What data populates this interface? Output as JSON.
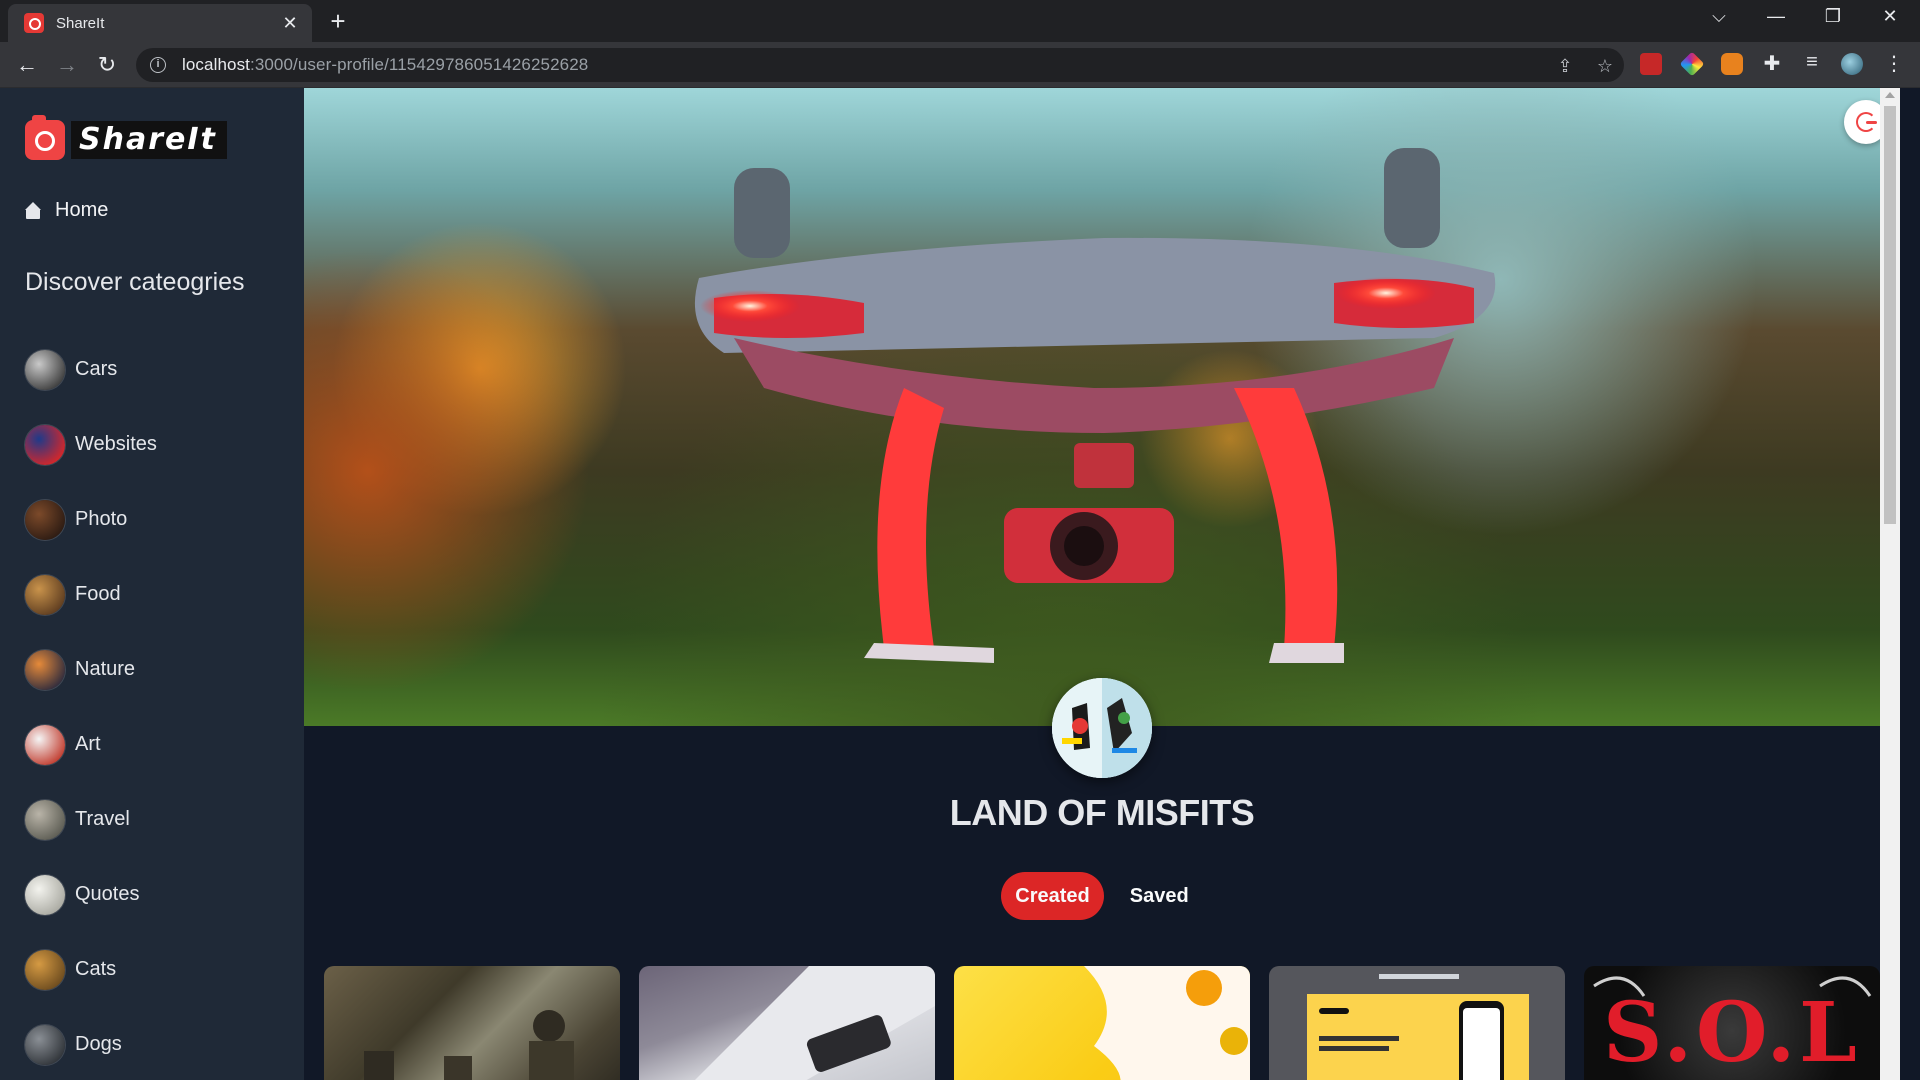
{
  "browser": {
    "tab_title": "ShareIt",
    "tab_close": "✕",
    "new_tab": "+",
    "url_host": "localhost",
    "url_path": ":3000/user-profile/115429786051426252628",
    "window_controls": {
      "dropdown": "⌵",
      "minimize": "—",
      "restore": "❐",
      "close": "✕"
    },
    "nav": {
      "back": "←",
      "forward": "→",
      "reload": "↻"
    },
    "menu": "⋮"
  },
  "sidebar": {
    "logo_text": "ShareIt",
    "home_label": "Home",
    "categories_heading": "Discover cateogries",
    "categories": [
      {
        "label": "Cars",
        "colors": [
          "#c9c9c9",
          "#3b3b3b"
        ]
      },
      {
        "label": "Websites",
        "colors": [
          "#1e3a8a",
          "#dc2626"
        ]
      },
      {
        "label": "Photo",
        "colors": [
          "#7c4a2a",
          "#2b1a12"
        ]
      },
      {
        "label": "Food",
        "colors": [
          "#c9934b",
          "#5c3b1f"
        ]
      },
      {
        "label": "Nature",
        "colors": [
          "#e58a3a",
          "#2d2a3d"
        ]
      },
      {
        "label": "Art",
        "colors": [
          "#f5f5f5",
          "#c0392b"
        ]
      },
      {
        "label": "Travel",
        "colors": [
          "#b9b4a8",
          "#5b5b52"
        ]
      },
      {
        "label": "Quotes",
        "colors": [
          "#f3f3ee",
          "#a8a8a0"
        ]
      },
      {
        "label": "Cats",
        "colors": [
          "#d59a43",
          "#6b4a1e"
        ]
      },
      {
        "label": "Dogs",
        "colors": [
          "#8a8f95",
          "#2f3338"
        ]
      }
    ]
  },
  "profile": {
    "username": "LAND OF MISFITS",
    "tabs": [
      {
        "label": "Created",
        "active": true
      },
      {
        "label": "Saved",
        "active": false
      }
    ]
  },
  "colors": {
    "accent": "#dc2626",
    "sidebar_bg": "#1f2937",
    "page_bg": "#111827"
  }
}
